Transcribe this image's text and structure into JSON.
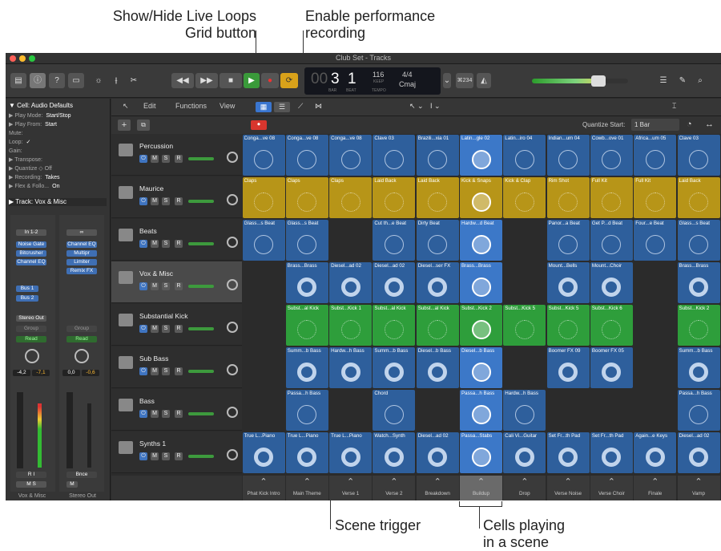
{
  "callouts": {
    "show_hide_line1": "Show/Hide Live Loops",
    "show_hide_line2": "Grid button",
    "enable_perf_line1": "Enable performance",
    "enable_perf_line2": "recording",
    "scene_trigger": "Scene trigger",
    "cells_line1": "Cells playing",
    "cells_line2": "in a scene"
  },
  "window": {
    "title": "Club Set - Tracks"
  },
  "lcd": {
    "bar": "3",
    "beat": "1",
    "tempo": "116",
    "tempo_sub": "KEEP",
    "sig": "4/4",
    "key": "Cmaj",
    "bar_lbl": "BAR",
    "beat_lbl": "BEAT",
    "tempo_lbl": "TEMPO",
    "pre": "00",
    "cpu": "⌘234"
  },
  "inspector": {
    "cell_header": "▼ Cell: Audio Defaults",
    "rows": [
      {
        "label": "▶  Play Mode:",
        "value": "Start/Stop"
      },
      {
        "label": "▶  Play From:",
        "value": "Start"
      },
      {
        "label": "Mute:",
        "value": ""
      },
      {
        "label": "Loop:",
        "value": "✓"
      },
      {
        "label": "Gain:",
        "value": ""
      },
      {
        "label": "▶  Transpose:",
        "value": ""
      },
      {
        "label": "▶  Quantize ◇ Off",
        "value": ""
      },
      {
        "label": "▶  Recording:",
        "value": "Takes"
      },
      {
        "label": "▶ Flex & Follo...",
        "value": "On"
      }
    ],
    "track_header": "▶ Track:  Vox & Misc",
    "input_label": "In 1-2",
    "plugins_left": [
      "Noise Gate",
      "Bitcrusher",
      "Channel EQ"
    ],
    "plugins_right": [
      "Channel EQ",
      "Multipr",
      "Limiter",
      "Remix FX"
    ],
    "bus": [
      "Bus 1",
      "Bus 2"
    ],
    "stereo_out": "Stereo Out",
    "group": "Group",
    "read": "Read",
    "vals_left": [
      "-4,2",
      "-7,1"
    ],
    "vals_right": [
      "0,0",
      "-0,6"
    ],
    "bnce": "Bnce",
    "ri": "R  I",
    "ms": "M    S",
    "m": "M",
    "strip_left": "Vox & Misc",
    "strip_right": "Stereo Out"
  },
  "edit_bar": {
    "edit": "Edit",
    "functions": "Functions",
    "view": "View",
    "quantize_label": "Quantize Start:",
    "quantize_value": "1 Bar"
  },
  "tracks": [
    {
      "name": "Percussion",
      "icon": "drum-icon"
    },
    {
      "name": "Maurice",
      "icon": "drum-machine-icon"
    },
    {
      "name": "Beats",
      "icon": "drum-machine-icon"
    },
    {
      "name": "Vox & Misc",
      "icon": "waveform-icon"
    },
    {
      "name": "Substantial Kick",
      "icon": "keyboard-icon"
    },
    {
      "name": "Sub Bass",
      "icon": "keyboard-icon"
    },
    {
      "name": "Bass",
      "icon": "keyboard-icon"
    },
    {
      "name": "Synths 1",
      "icon": "synth-icon"
    }
  ],
  "track_buttons": {
    "m": "M",
    "s": "S",
    "r": "R",
    "power": "⏻"
  },
  "colors": {
    "blue": "#2e5f9c",
    "yellow": "#b79518",
    "green": "#2e9e3b",
    "playing": "#3c78c8"
  },
  "cells": [
    [
      "Conga...ve 08",
      "Conga...ve 08",
      "Conga...ve 08",
      "Clave 03",
      "Brazili...xia 01",
      "Latin...gle 02",
      "Latin...iro 04",
      "Indian...um 04",
      "Cowb...ove 01",
      "Africa...um 05",
      "Clave 03"
    ],
    [
      "Claps",
      "Claps",
      "Claps",
      "Laid Back",
      "Laid Back",
      "Kick & Snaps",
      "Kick & Clap",
      "Rim Shot",
      "Full Kit",
      "Full Kit",
      "Laid Back"
    ],
    [
      "Glass...s Beat",
      "Glass...s Beat",
      "",
      "Cut th...e Beat",
      "Dirty Beat",
      "Hardw...d Beat",
      "",
      "Panor...a Beat",
      "Get P...d Beat",
      "Four...e Beat",
      "Glass...s Beat"
    ],
    [
      "",
      "Brass...Brass",
      "Diesel...ad 02",
      "Diesel...ad 02",
      "Diesel...ser FX",
      "Brass...Brass",
      "",
      "Mount...Bells",
      "Mount...Choir",
      "",
      "Brass...Brass"
    ],
    [
      "",
      "Subst...al Kick",
      "Subst...Kick 1",
      "Subst...al Kick",
      "Subst...al Kick",
      "Subst...Kick 2",
      "Subst...Kick 5",
      "Subst...Kick 5",
      "Subst...Kick 6",
      "",
      "Subst...Kick 2"
    ],
    [
      "",
      "Summ...b Bass",
      "Hardw...h Bass",
      "Summ...b Bass",
      "Diesel...b Bass",
      "Diesel...b Bass",
      "",
      "Boomer FX 09",
      "Boomer FX 05",
      "",
      "Summ...b Bass"
    ],
    [
      "",
      "Passa...h Bass",
      "",
      "Chord",
      "",
      "Passa...h Bass",
      "Hardw...h Bass",
      "",
      "",
      "",
      "Passa...h Bass"
    ],
    [
      "True L...Piano",
      "True L...Piano",
      "True L...Piano",
      "Watch...Synth",
      "Diesel...ad 02",
      "Passa...Stabs",
      "Cali Vi...Guitar",
      "Set Fr...th Pad",
      "Set Fr...th Pad",
      "Again...e Keys",
      "Diesel...ad 02"
    ]
  ],
  "scenes": [
    "Phat Kick Intro",
    "Main Theme",
    "Verse 1",
    "Verse 2",
    "Breakdown",
    "Buildup",
    "Drop",
    "Verse Noise",
    "Verse Choir",
    "Finale",
    "Vamp"
  ],
  "playing_scene": 5
}
